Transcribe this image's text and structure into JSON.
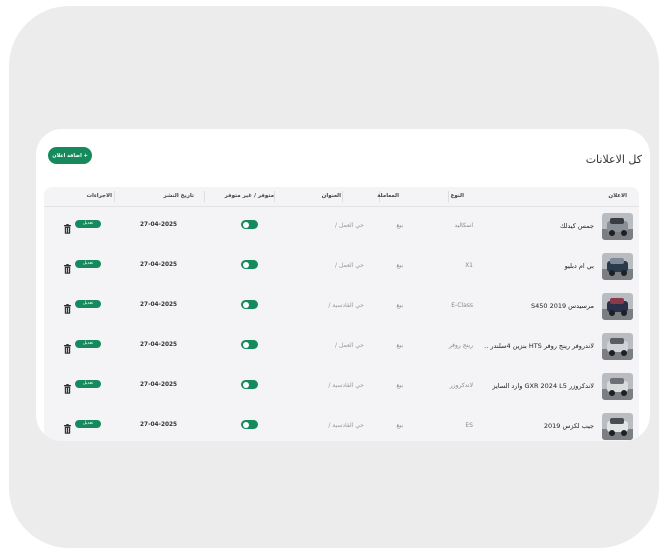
{
  "header": {
    "title": "كل الاعلانات",
    "add_button_label": "اضافة اعلان +"
  },
  "table": {
    "columns": [
      "الاعلان",
      "النوع",
      "المعاملة",
      "العنوان",
      "متوفر / غير متوفر",
      "تاريخ النشر",
      "الاجراءات"
    ],
    "edit_label": "تعديل",
    "rows": [
      {
        "title": "جمس كيدلك",
        "type": "اسكاليد",
        "deal": "بيع",
        "address": "حي العمل /",
        "available": true,
        "date": "27-04-2025",
        "thumb_colors": [
          "#8a8f95",
          "#3a3d42"
        ]
      },
      {
        "title": "بي ام دبليو",
        "type": "X1",
        "deal": "بيع",
        "address": "حي العمل /",
        "available": true,
        "date": "27-04-2025",
        "thumb_colors": [
          "#2b3a4a",
          "#7d8a96"
        ]
      },
      {
        "title": "مرسيدس 2019 S450",
        "type": "E-Class",
        "deal": "بيع",
        "address": "حي القادسية /",
        "available": true,
        "date": "27-04-2025",
        "thumb_colors": [
          "#2a2f4a",
          "#8a3a4a"
        ]
      },
      {
        "title": "لاندروفر رينج روفر HTS بنزين 4سلندر ..",
        "type": "رينج روفر",
        "deal": "بيع",
        "address": "حي العمل /",
        "available": true,
        "date": "27-04-2025",
        "thumb_colors": [
          "#cfd2d6",
          "#5a5e63"
        ]
      },
      {
        "title": "لاندكروزر GXR 2024 L5 وارد السايز",
        "type": "لاندكروزر",
        "deal": "بيع",
        "address": "حي القادسية /",
        "available": true,
        "date": "27-04-2025",
        "thumb_colors": [
          "#d8dadc",
          "#6d7176"
        ]
      },
      {
        "title": "جيب لكزس 2019",
        "type": "ES",
        "deal": "بيع",
        "address": "حي القادسية /",
        "available": true,
        "date": "27-04-2025",
        "thumb_colors": [
          "#e2e4e6",
          "#4a4d52"
        ]
      }
    ]
  },
  "colors": {
    "accent": "#168a5c",
    "frame": "#ececec",
    "table_bg": "#f4f4f7"
  }
}
